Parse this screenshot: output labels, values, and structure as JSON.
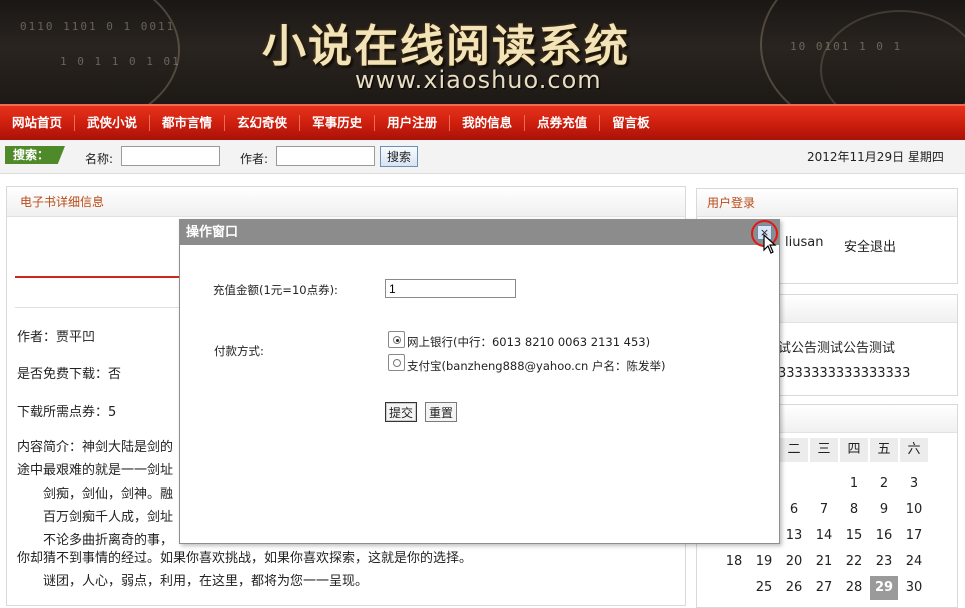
{
  "banner": {
    "title": "小说在线阅读系统",
    "url": "www.xiaoshuo.com"
  },
  "nav": {
    "items": [
      "网站首页",
      "武侠小说",
      "都市言情",
      "玄幻奇侠",
      "军事历史",
      "用户注册",
      "我的信息",
      "点券充值",
      "留言板"
    ]
  },
  "search": {
    "tag": "搜索：",
    "name_label": "名称:",
    "name_value": "",
    "author_label": "作者:",
    "author_value": "",
    "button": "搜索",
    "date": "2012年11月29日  星期四"
  },
  "main": {
    "heading": "电子书详细信息",
    "author": "作者：贾平凹",
    "free_download": "是否免费下载：否",
    "coupons_needed": "下载所需点券：5",
    "summary_lines": [
      "内容简介：神剑大陆是剑的",
      "途中最艰难的就是一一剑址",
      "剑痴，剑仙，剑神。融",
      "百万剑痴千人成，剑址",
      "不论多曲折离奇的事，",
      "你却猜不到事情的经过。如果你喜欢挑战，如果你喜欢探索，这就是你的选择。",
      "谜团，人心，弱点，利用，在这里，都将为您一一呈现。"
    ]
  },
  "sidebar": {
    "login_heading": "用户登录",
    "username": "liusan",
    "logout": "安全退出",
    "notice_line1": "试公告测试公告测试",
    "notice_line2": "3333333333333333",
    "calendar": {
      "weekdays": [
        "二",
        "三",
        "四",
        "五",
        "六"
      ],
      "rows": [
        [
          "",
          "",
          "1",
          "2",
          "3"
        ],
        [
          "6",
          "7",
          "8",
          "9",
          "10"
        ],
        [
          "13",
          "14",
          "15",
          "16",
          "17"
        ],
        [
          "19",
          "20",
          "21",
          "22",
          "23",
          "24"
        ],
        [
          "25",
          "26",
          "27",
          "28",
          "29",
          "30"
        ]
      ],
      "row4_lead": "18",
      "today": "29"
    }
  },
  "modal": {
    "title": "操作窗口",
    "close": "×",
    "amount_label": "充值金额(1元=10点券):",
    "amount_value": "1",
    "payment_label": "付款方式:",
    "option_bank": "网上银行(中行：6013 8210 0063 2131 453)",
    "option_alipay": "支付宝(banzheng888@yahoo.cn 户名：陈发举)",
    "submit": "提交",
    "reset": "重置"
  },
  "colors": {
    "nav_red": "#c81c0c",
    "panel_heading": "#b94a16",
    "search_tag_green": "#4f8a2a",
    "modal_header": "#8c8c8c",
    "today_bg": "#9a9a9a"
  }
}
